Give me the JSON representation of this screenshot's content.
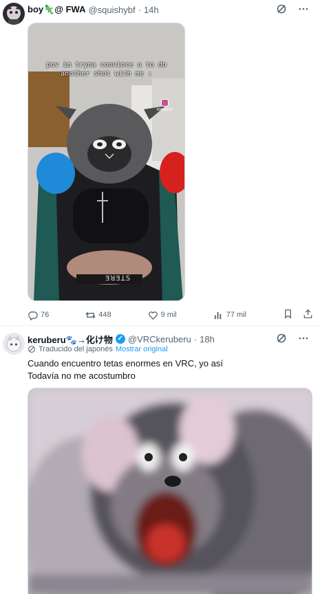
{
  "post1": {
    "name": "boy🦎@ FWA",
    "handle": "@squishybf",
    "dot": "·",
    "time": "14h",
    "media_caption": "pov im tryna convince u to do\nanother shot with me :",
    "media_watermark": "KOKABOOF",
    "media_waistband_text": "ƎꓤƎꓕꓢ",
    "stats": {
      "replies": "76",
      "reposts": "448",
      "likes": "9 mil",
      "views": "77 mil"
    }
  },
  "post2": {
    "name": "keruberu🐾→化け物",
    "handle": "@VRCkeruberu",
    "dot": "·",
    "time": "18h",
    "translated_label": "Traducido del japonés",
    "show_original": "Mostrar original",
    "text_line1": "Cuando encuentro tetas enormes en VRC, yo así",
    "text_line2": "Todavía no me acostumbro"
  },
  "colors": {
    "accent": "#1d9bf0",
    "muted": "#536471",
    "border": "#eff3f4"
  },
  "icons": [
    "grok-icon",
    "more-icon",
    "reply-icon",
    "repost-icon",
    "like-icon",
    "views-icon",
    "bookmark-icon",
    "share-icon",
    "verified-icon",
    "translate-icon"
  ]
}
